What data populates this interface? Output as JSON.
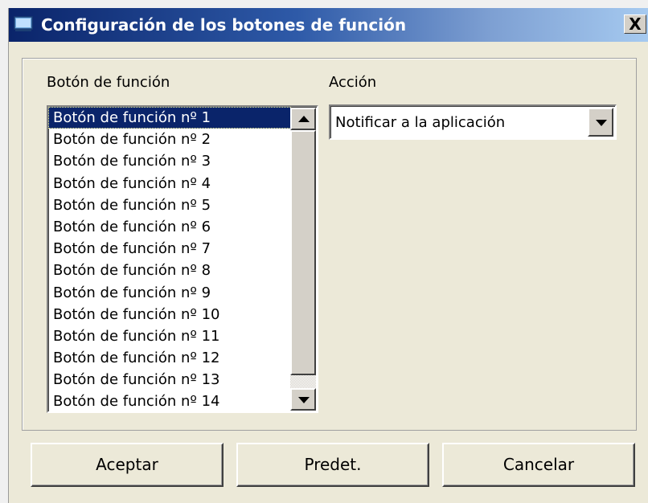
{
  "window": {
    "title": "Configuración de los botones de función",
    "close_label": "X"
  },
  "labels": {
    "function_button": "Botón de función",
    "action": "Acción"
  },
  "function_list": {
    "items": [
      "Botón de función nº 1",
      "Botón de función nº 2",
      "Botón de función nº 3",
      "Botón de función nº 4",
      "Botón de función nº 5",
      "Botón de función nº 6",
      "Botón de función nº 7",
      "Botón de función nº 8",
      "Botón de función nº 9",
      "Botón de función nº 10",
      "Botón de función nº 11",
      "Botón de función nº 12",
      "Botón de función nº 13",
      "Botón de función nº 14"
    ],
    "selected_index": 0
  },
  "action_combo": {
    "value": "Notificar a la aplicación"
  },
  "buttons": {
    "accept": "Aceptar",
    "default": "Predet.",
    "cancel": "Cancelar"
  },
  "colors": {
    "selection": "#0a246a",
    "title_bar_start": "#0a246a",
    "title_bar_end": "#a6caf0"
  }
}
